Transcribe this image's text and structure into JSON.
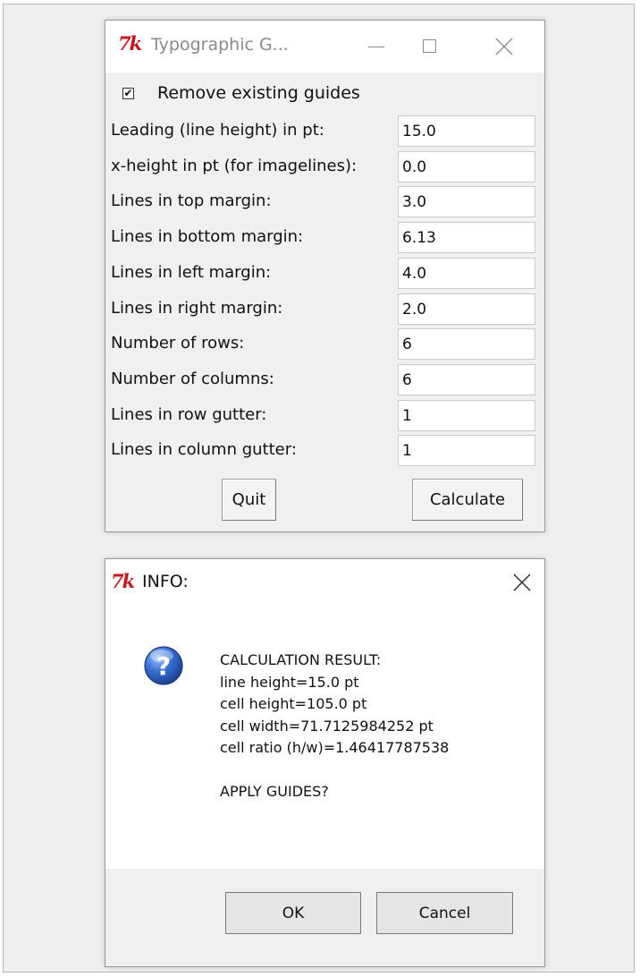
{
  "main_window": {
    "title": "Typographic G...",
    "checkbox": {
      "label": "Remove existing guides",
      "checked": true,
      "mark": "✔"
    },
    "fields": [
      {
        "label": "Leading (line height) in pt:",
        "value": "15.0"
      },
      {
        "label": "x-height in pt (for imagelines):",
        "value": "0.0"
      },
      {
        "label": "Lines in top margin:",
        "value": "3.0"
      },
      {
        "label": "Lines in bottom margin:",
        "value": "6.13"
      },
      {
        "label": "Lines in left margin:",
        "value": "4.0"
      },
      {
        "label": "Lines in right margin:",
        "value": "2.0"
      },
      {
        "label": "Number of rows:",
        "value": "6"
      },
      {
        "label": "Number of columns:",
        "value": "6"
      },
      {
        "label": "Lines in row gutter:",
        "value": "1"
      },
      {
        "label": "Lines in column gutter:",
        "value": "1"
      }
    ],
    "buttons": {
      "quit": "Quit",
      "calculate": "Calculate"
    }
  },
  "info_window": {
    "title": "INFO:",
    "icon": "question-icon",
    "message": [
      "CALCULATION RESULT:",
      "line height=15.0 pt",
      "cell height=105.0 pt",
      "cell width=71.7125984252 pt",
      "cell ratio (h/w)=1.46417787538",
      "",
      "APPLY GUIDES?"
    ],
    "buttons": {
      "ok": "OK",
      "cancel": "Cancel"
    }
  },
  "app_logo": "7k",
  "colors": {
    "tk_logo": "#c8181e",
    "question_icon": "#2b5fb8"
  }
}
